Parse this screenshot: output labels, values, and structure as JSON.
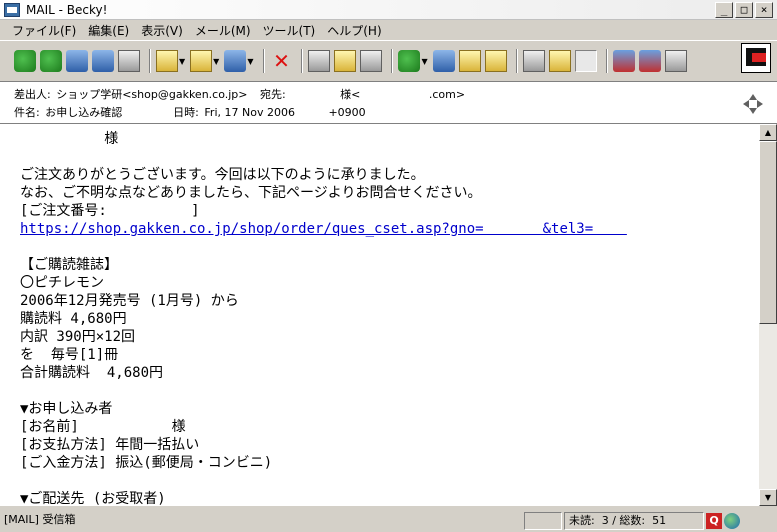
{
  "window": {
    "title": "MAIL - Becky!"
  },
  "menu": [
    "ファイル(F)",
    "編集(E)",
    "表示(V)",
    "メール(M)",
    "ツール(T)",
    "ヘルプ(H)"
  ],
  "header": {
    "from_label": "差出人:",
    "from_value": "ショップ学研<shop@gakken.co.jp>",
    "to_label": "宛先:",
    "to_value": "様<",
    "to_domain": ".com>",
    "subject_label": "件名:",
    "subject_value": "お申し込み確認",
    "date_label": "日時:",
    "date_value": "Fri, 17 Nov 2006",
    "tz": "+0900"
  },
  "body_lines": [
    "          様",
    "",
    "ご注文ありがとうございます。今回は以下のように承りました。",
    "なお、ご不明な点などありましたら、下記ページよりお問合せください。",
    "[ご注文番号:          ]",
    "",
    "",
    "【ご購読雑誌】",
    "〇ピチレモン",
    "2006年12月発売号 (1月号) から",
    "購読料 4,680円",
    "内訳 390円×12回",
    "を  毎号[1]冊",
    "合計購読料  4,680円",
    "",
    "▼お申し込み者",
    "[お名前]           様",
    "[お支払方法] 年間一括払い",
    "[ご入金方法] 振込(郵便局・コンビニ)",
    "",
    "▼ご配送先 (お受取者)"
  ],
  "body_link": "https://shop.gakken.co.jp/shop/order/ques_cset.asp?gno=       &tel3=    ",
  "status": {
    "folder": "[MAIL] 受信箱",
    "unread": "未読:  3 / 総数:  51"
  },
  "toolbar_icons": [
    "receive-icon",
    "send-icon",
    "send-receive-icon",
    "check-mail-icon",
    "computer-icon",
    "compose-icon",
    "reply-icon",
    "forward-icon",
    "delete-icon",
    "tree-icon",
    "pencil-icon",
    "edit-icon",
    "filter-icon",
    "address-icon",
    "clipboard-icon",
    "memo-icon",
    "folder-icon",
    "open-folder-icon",
    "preview-icon",
    "blog-icon",
    "blog-icon-2",
    "tools-icon"
  ]
}
